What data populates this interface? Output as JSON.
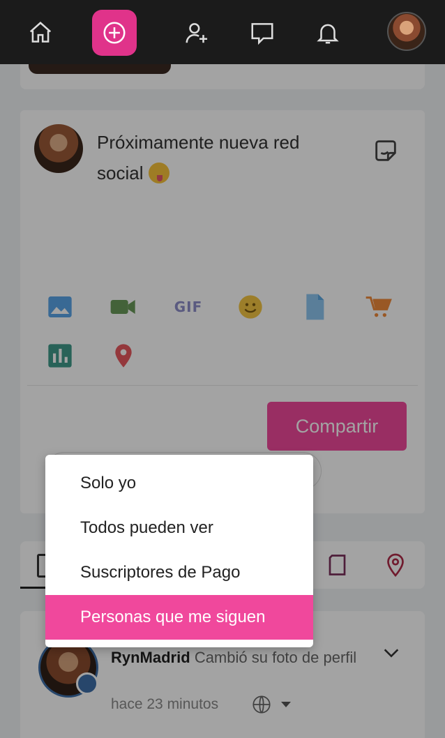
{
  "nav": {
    "items": [
      {
        "name": "home"
      },
      {
        "name": "create-post"
      },
      {
        "name": "add-friend"
      },
      {
        "name": "messages"
      },
      {
        "name": "notifications"
      },
      {
        "name": "profile"
      }
    ]
  },
  "composer": {
    "text": "Próximamente nueva red social",
    "emoji": "😜",
    "tools": [
      "image-icon",
      "video-icon",
      "gif-icon",
      "emoji-icon",
      "file-icon",
      "cart-icon",
      "poll-icon",
      "location-icon"
    ],
    "gif_label": "GIF",
    "share_label": "Compartir",
    "colors": {
      "accent": "#f0489c"
    }
  },
  "privacy_menu": {
    "options": [
      "Solo yo",
      "Todos pueden ver",
      "Suscriptores de Pago",
      "Personas que me siguen"
    ],
    "selected": "Personas que me siguen"
  },
  "feed": {
    "user": "RynMadrid",
    "action": "Cambió su foto de perfil",
    "time": "hace 23 minutos"
  }
}
